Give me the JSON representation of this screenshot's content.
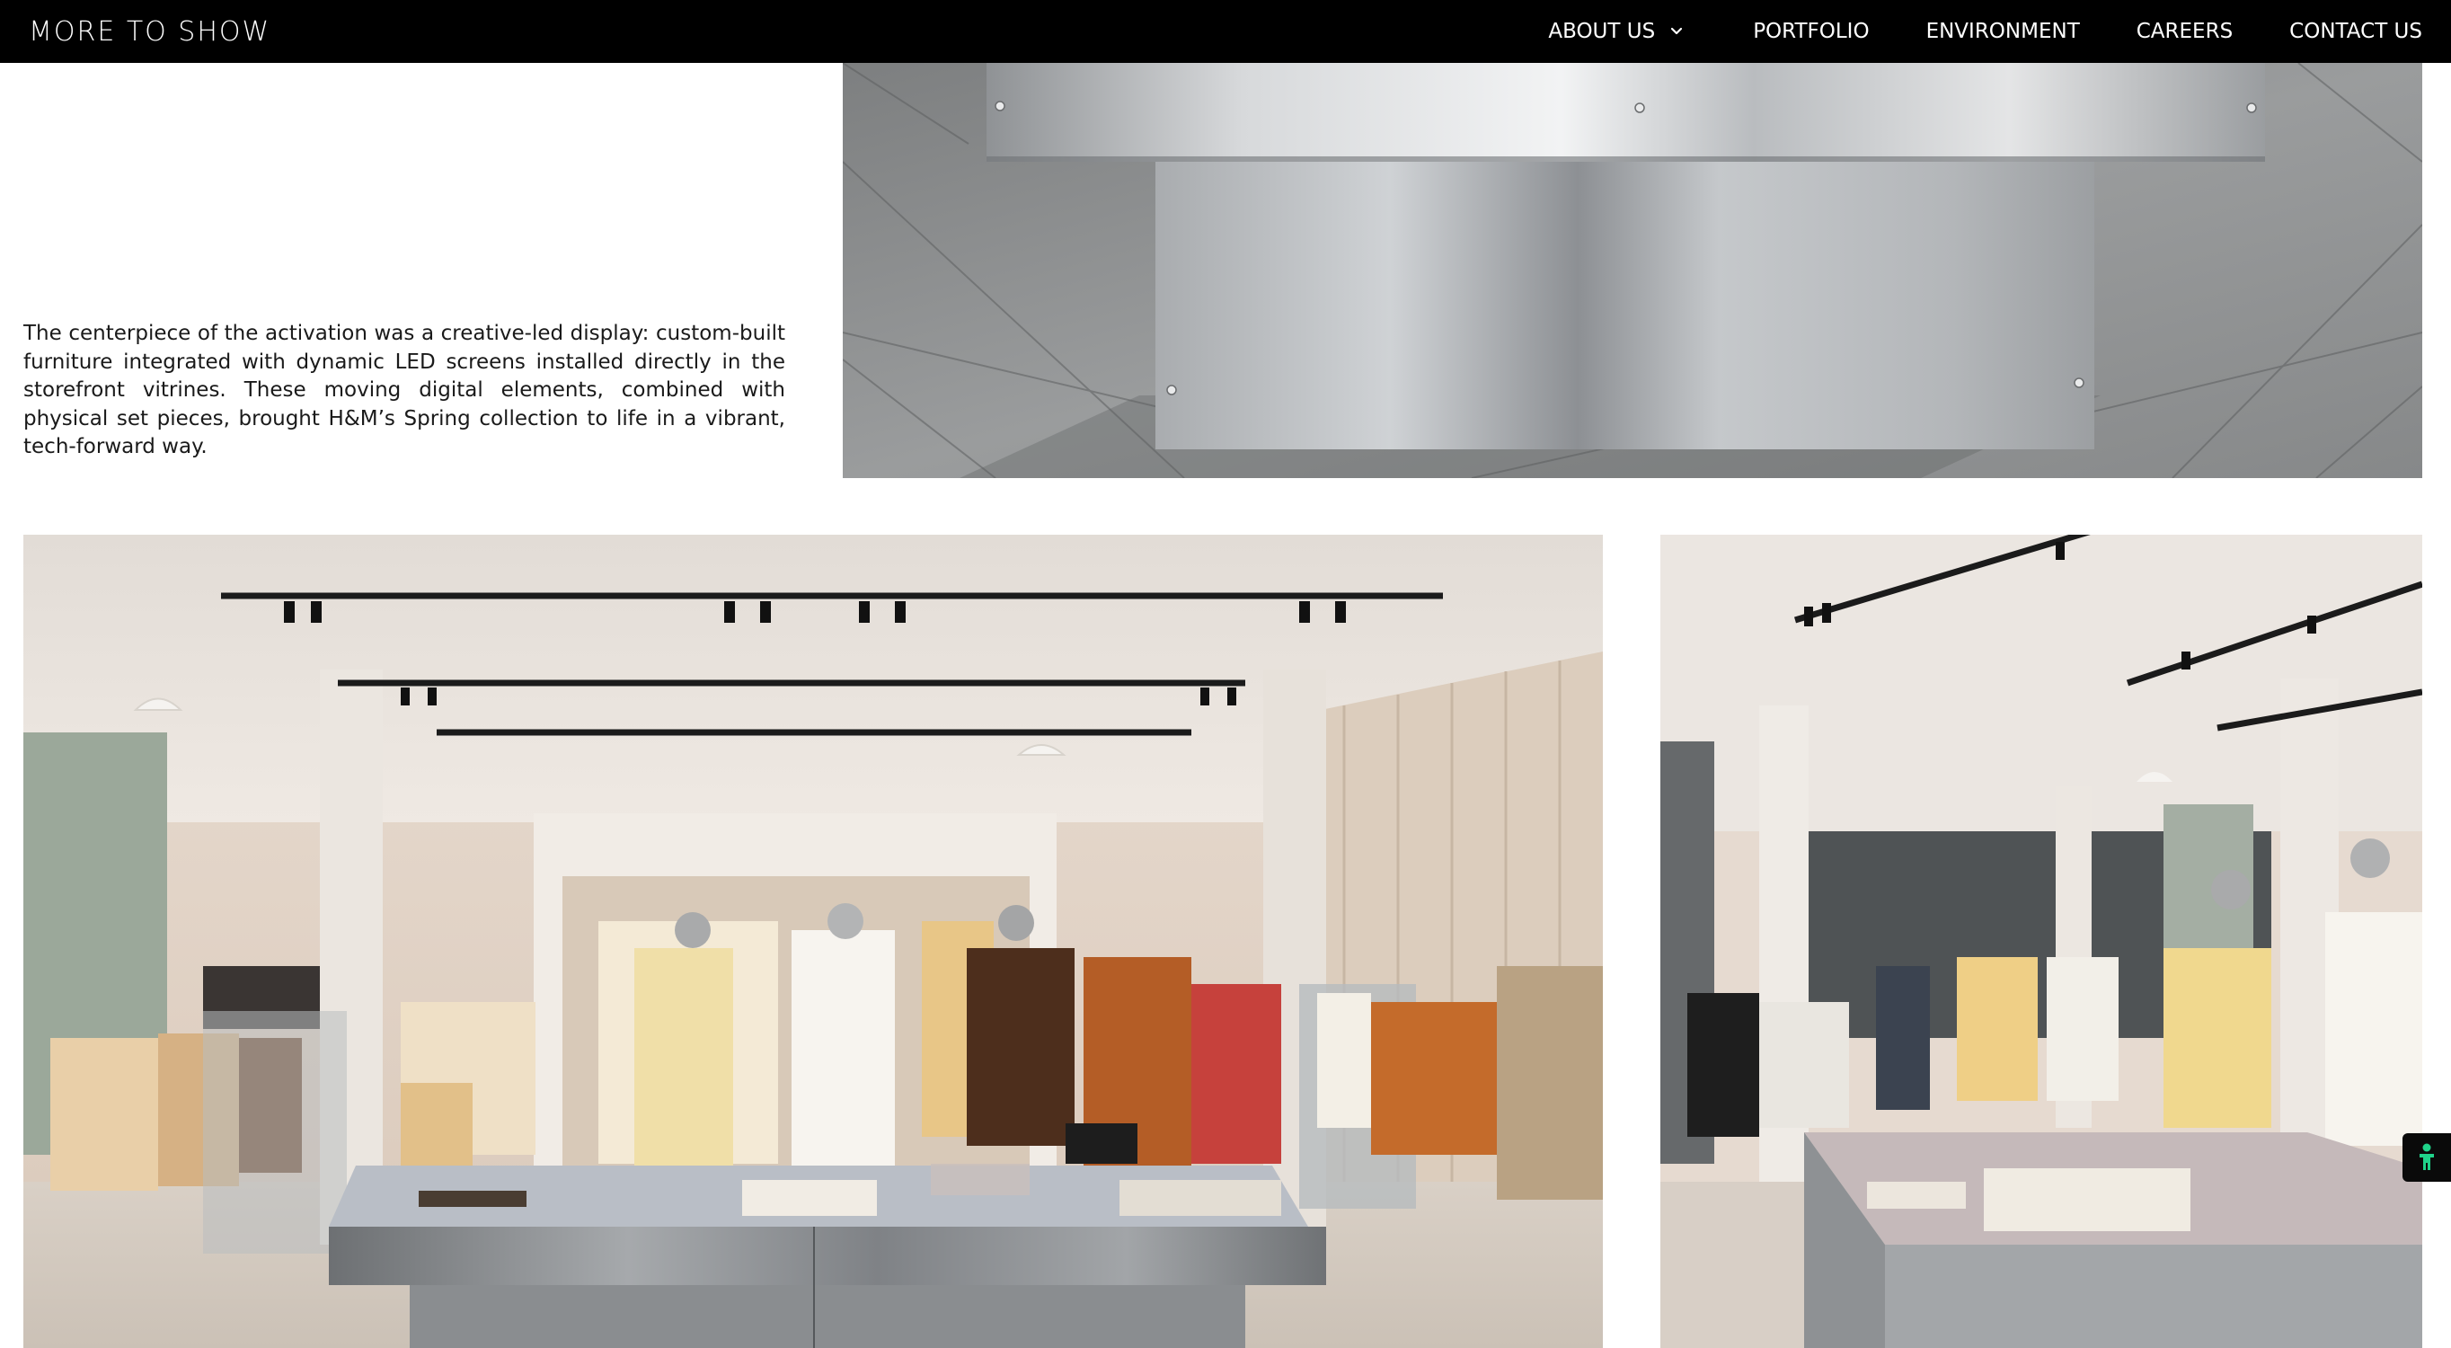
{
  "header": {
    "logo": "MORE TO SHOW",
    "nav": [
      {
        "label": "ABOUT US",
        "has_dropdown": true
      },
      {
        "label": "PORTFOLIO"
      },
      {
        "label": "ENVIRONMENT"
      },
      {
        "label": "CAREERS"
      },
      {
        "label": "CONTACT US"
      }
    ]
  },
  "main": {
    "intro_paragraph": "The centerpiece of the activation was a creative-led display: custom-built furniture integrated with dynamic LED screens installed directly in the storefront vitrines. These moving digital elements, combined with physical set pieces, brought H&M’s Spring collection to life in a vibrant, tech-forward way."
  },
  "widgets": {
    "accessibility_icon": "accessibility-person-icon",
    "accent_color": "#1fd38a"
  },
  "colors": {
    "header_bg": "#000000",
    "header_text": "#ffffff",
    "page_bg": "#ffffff"
  }
}
